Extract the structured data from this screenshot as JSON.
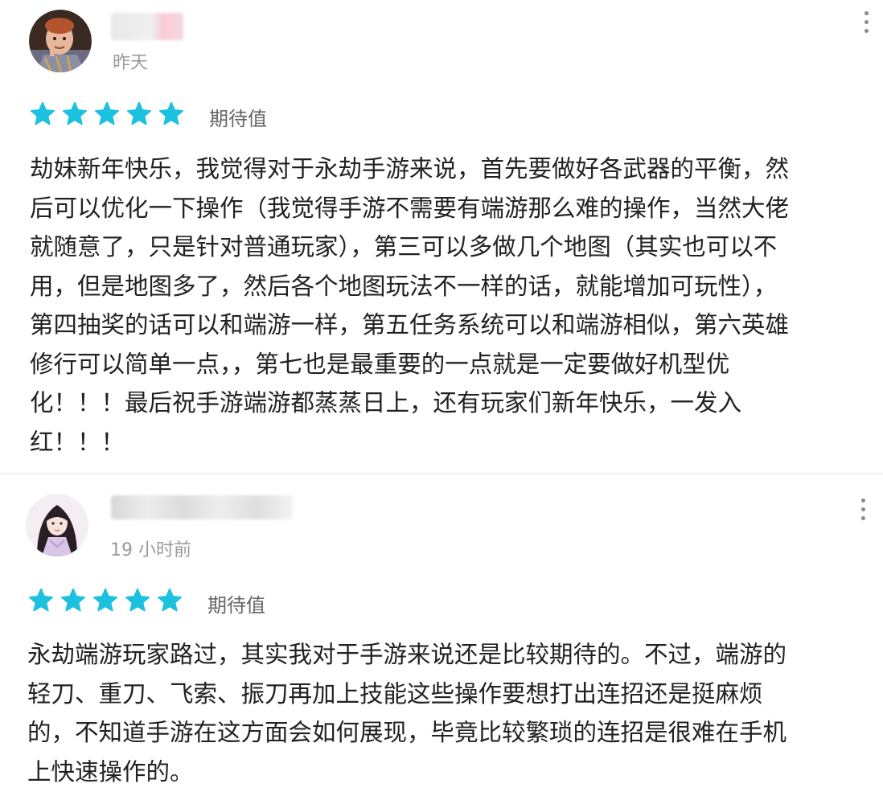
{
  "reviews": [
    {
      "time": "昨天",
      "rating_stars": 5,
      "rating_label": "期待值",
      "body_lines": [
        "劫妹新年快乐，我觉得对于永劫手游来说，首先要做好各武器的平衡，然",
        "后可以优化一下操作（我觉得手游不需要有端游那么难的操作，当然大佬",
        "就随意了，只是针对普通玩家），第三可以多做几个地图（其实也可以不",
        "用，但是地图多了，然后各个地图玩法不一样的话，就能增加可玩性），",
        "第四抽奖的话可以和端游一样，第五任务系统可以和端游相似，第六英雄",
        "修行可以简单一点，，第七也是最重要的一点就是一定要做好机型优",
        "化！！！最后祝手游端游都蒸蒸日上，还有玩家们新年快乐，一发入",
        "红！！！"
      ]
    },
    {
      "time": "19 小时前",
      "rating_stars": 5,
      "rating_label": "期待值",
      "body_lines": [
        "永劫端游玩家路过，其实我对于手游来说还是比较期待的。不过，端游的",
        "轻刀、重刀、飞索、振刀再加上技能这些操作要想打出连招还是挺麻烦",
        "的，不知道手游在这方面会如何展现，毕竟比较繁琐的连招是很难在手机",
        "上快速操作的。"
      ]
    }
  ],
  "colors": {
    "star": "#1cc1e0",
    "time_text": "#9a9a9a",
    "label_text": "#666666",
    "body_text": "#222222"
  },
  "icons": {
    "star": "star-icon",
    "more": "more-vertical-icon"
  }
}
